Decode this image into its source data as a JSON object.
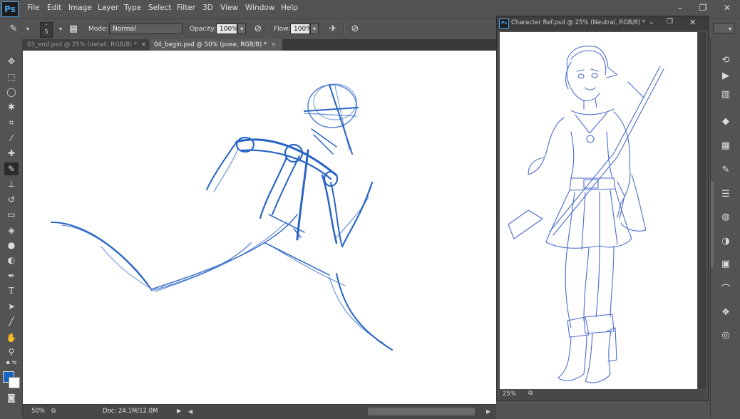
{
  "app": {
    "logo": "Ps"
  },
  "menu": [
    "File",
    "Edit",
    "Image",
    "Layer",
    "Type",
    "Select",
    "Filter",
    "3D",
    "View",
    "Window",
    "Help"
  ],
  "window_controls": {
    "minimize": "–",
    "restore": "❐",
    "close": "✕"
  },
  "options": {
    "brush_size": "5",
    "mode_label": "Mode:",
    "mode_value": "Normal",
    "opacity_label": "Opacity:",
    "opacity_value": "100%",
    "flow_label": "Flow:",
    "flow_value": "100%"
  },
  "tabs": [
    {
      "label": "03_end.psd @ 25% (detail, RGB/8) *",
      "active": false
    },
    {
      "label": "04_begin.psd @ 50% (pose, RGB/8) *",
      "active": true
    }
  ],
  "tab_close": "×",
  "status": {
    "zoom": "50%",
    "doc": "Doc: 24.1M/12.0M"
  },
  "ref_window": {
    "title": "Character Ref.psd @ 25% (Neutral, RGB/8) *",
    "zoom": "25%",
    "controls": {
      "minimize": "–",
      "restore": "❐",
      "close": "✕"
    }
  },
  "colors": {
    "foreground": "#1565c0",
    "background": "#ffffff",
    "sketch_stroke": "#1f5fbf",
    "ref_stroke": "#4a6fcf"
  },
  "tools": [
    "move-icon",
    "marquee-icon",
    "lasso-icon",
    "magic-wand-icon",
    "crop-icon",
    "eyedropper-icon",
    "spot-heal-icon",
    "brush-icon",
    "clone-stamp-icon",
    "history-brush-icon",
    "eraser-icon",
    "paint-bucket-icon",
    "blur-icon",
    "dodge-icon",
    "pen-icon",
    "type-icon",
    "path-select-icon",
    "line-icon",
    "hand-icon",
    "zoom-icon"
  ],
  "dock_icons": [
    "history-icon",
    "actions-icon",
    "swatches-icon",
    "layers-icon",
    "channels-icon",
    "brush-presets-icon",
    "adjustments-icon",
    "styles-icon",
    "color-icon",
    "navigator-icon",
    "curves-icon",
    "paths-icon",
    "properties-icon"
  ]
}
